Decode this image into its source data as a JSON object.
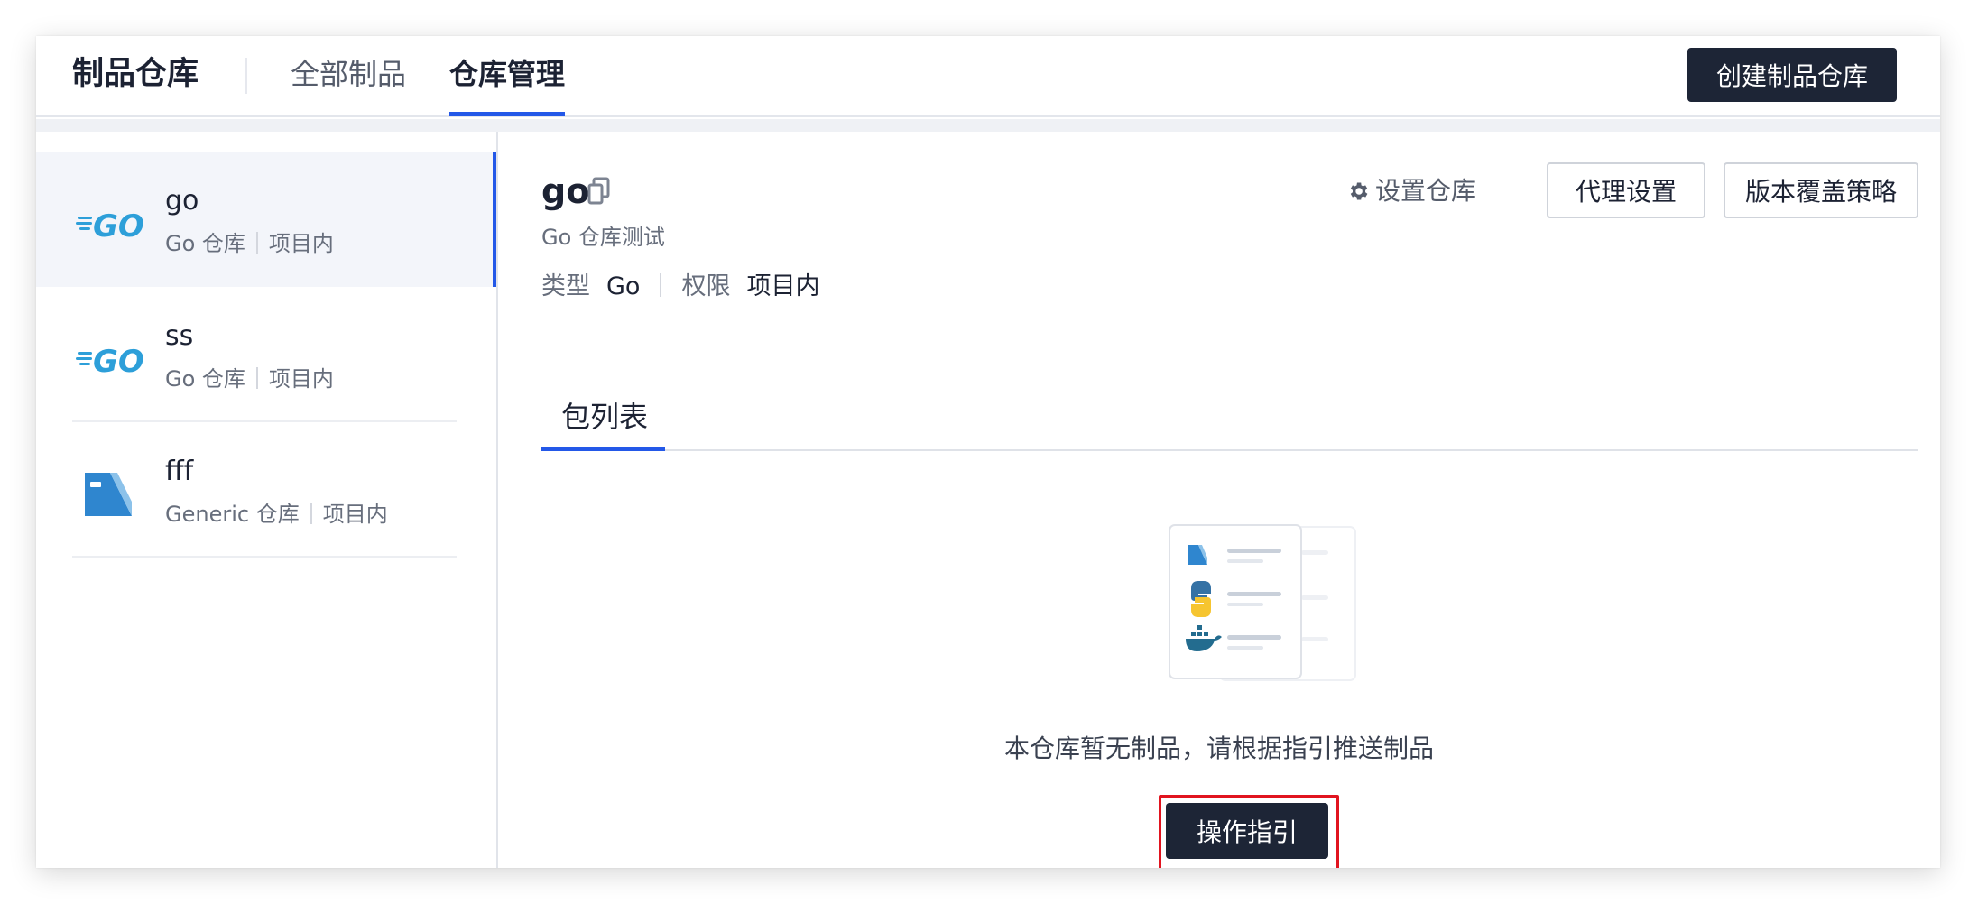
{
  "header": {
    "brand": "制品仓库",
    "tabs": [
      {
        "label": "全部制品",
        "active": false
      },
      {
        "label": "仓库管理",
        "active": true
      }
    ],
    "create_button": "创建制品仓库"
  },
  "sidebar": {
    "items": [
      {
        "name": "go",
        "type": "Go 仓库",
        "scope": "项目内",
        "icon": "go-logo-icon",
        "active": true
      },
      {
        "name": "ss",
        "type": "Go 仓库",
        "scope": "项目内",
        "icon": "go-logo-icon",
        "active": false
      },
      {
        "name": "fff",
        "type": "Generic 仓库",
        "scope": "项目内",
        "icon": "generic-repo-icon",
        "active": false
      }
    ]
  },
  "main": {
    "repo_name": "go",
    "description": "Go 仓库测试",
    "type_label": "类型",
    "type_value": "Go",
    "permission_label": "权限",
    "permission_value": "项目内",
    "settings_link": "设置仓库",
    "proxy_button": "代理设置",
    "version_button": "版本覆盖策略",
    "tab_label": "包列表",
    "empty_text": "本仓库暂无制品，请根据指引推送制品",
    "guide_button": "操作指引"
  },
  "colors": {
    "accent": "#2358e8",
    "dark_button": "#1d2536",
    "highlight_frame": "#e1141f",
    "go_blue": "#2d9fd9"
  }
}
